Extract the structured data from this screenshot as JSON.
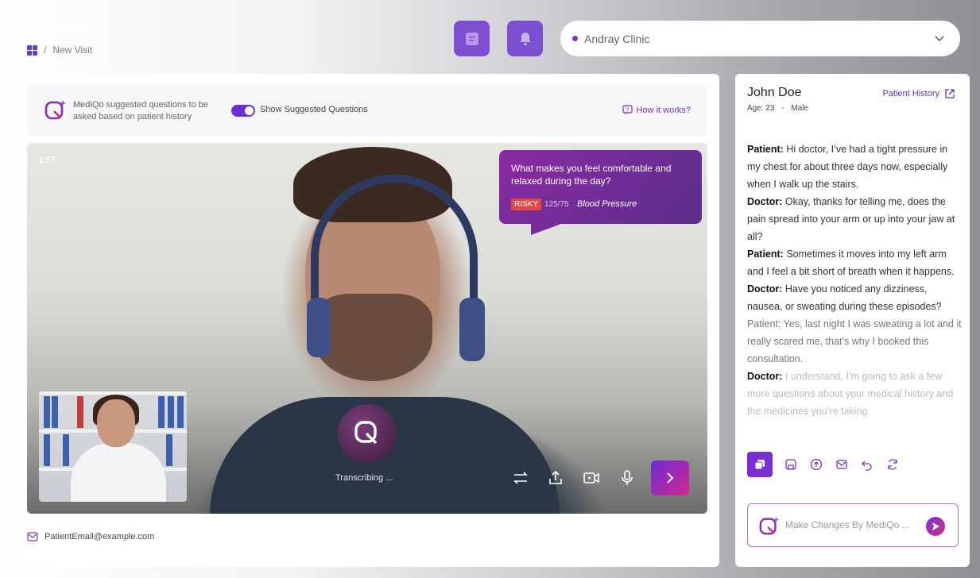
{
  "header": {
    "page_title": "New Visit",
    "breadcrumb": [
      "New Visit"
    ],
    "clinic_select": "Andray Clinic"
  },
  "suggestions": {
    "text": "MediQo suggested questions to be asked based on patient history",
    "toggle_label": "Show Suggested Questions",
    "toggle_on": true,
    "how_link": "How it works?"
  },
  "video": {
    "elapsed": "2:57",
    "suggested_question": "What makes you feel comfortable and relaxed during the day?",
    "badge": "RISKY",
    "vital_value": "125/75",
    "vital_label": "Blood Pressure",
    "status": "Transcribing ..."
  },
  "patient_email": "PatientEmail@example.com",
  "patient": {
    "name": "John Doe",
    "age_label": "Age: 23",
    "sep": "-",
    "gender": "Male",
    "history_link": "Patient History"
  },
  "transcript": [
    {
      "speaker": "Patient:",
      "text": " Hi doctor, I’ve had a tight pressure in my chest for about three days now, especially when I walk up the stairs."
    },
    {
      "speaker": "Doctor:",
      "text": " Okay, thanks for telling me, does the pain spread into your arm or up into your jaw at all?"
    },
    {
      "speaker": "Patient:",
      "text": " Sometimes it moves into my left arm and I feel a bit short of breath when it happens."
    },
    {
      "speaker": "Doctor:",
      "text": " Have you noticed any dizziness, nausea, or sweating during these episodes?"
    },
    {
      "speaker": "",
      "text": " Patient: Yes, last night I was sweating a lot and it really scared me, that’s why I booked this consultation."
    },
    {
      "speaker": "Doctor:",
      "text": " I understand, I’m going to ask a few more questions about your medical history and the medicines you’re taking."
    }
  ],
  "composer": {
    "placeholder": "Make Changes By MediQo ..."
  },
  "colors": {
    "accent": "#7c4fd2",
    "risky": "#e04848",
    "bubble": "#7a2a9a"
  },
  "icons": {
    "notes": "notes-icon",
    "bell": "bell-icon",
    "grid": "grid-icon"
  }
}
